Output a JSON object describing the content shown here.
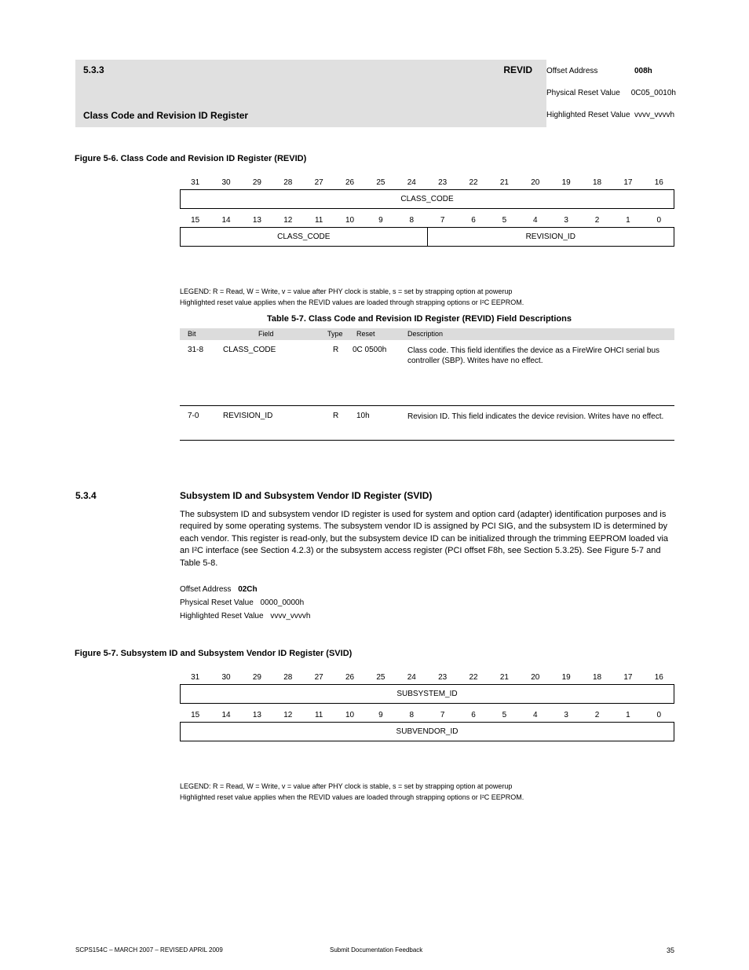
{
  "topband": {
    "label": "5.3.3",
    "abbr": "REVID",
    "sub": "Class Code and Revision ID Register"
  },
  "offbox": {
    "offset_k": "Offset Address",
    "offset_v": "008h",
    "reset_k": "Physical Reset Value",
    "reset_v": "0C05_0010h",
    "hi_k": "Highlighted Reset Value",
    "hi_v": "vvvv_vvvvh"
  },
  "sect_b": {
    "num": "5.3.4",
    "title": "Subsystem ID and Subsystem Vendor ID Register (SVID)"
  },
  "fig1": "Figure 5-6. Class Code and Revision ID Register (REVID)",
  "fig2": "Figure 5-7. Subsystem ID and Subsystem Vendor ID Register (SVID)",
  "bits_hi": [
    "31",
    "30",
    "29",
    "28",
    "27",
    "26",
    "25",
    "24",
    "23",
    "22",
    "21",
    "20",
    "19",
    "18",
    "17",
    "16"
  ],
  "bits_lo": [
    "15",
    "14",
    "13",
    "12",
    "11",
    "10",
    "9",
    "8",
    "7",
    "6",
    "5",
    "4",
    "3",
    "2",
    "1",
    "0"
  ],
  "reg1": {
    "a": "CLASS_CODE",
    "b": "CLASS_CODE",
    "c": "REVISION_ID"
  },
  "reg2": {
    "a": "SUBSYSTEM_ID",
    "b": "SUBVENDOR_ID"
  },
  "legend1a": "LEGEND: R = Read, W = Write, v = value after PHY clock is stable, s = set by strapping option at powerup",
  "legend1b": "Highlighted reset value applies when the REVID values are loaded through strapping options or I²C EEPROM.",
  "tbl1": {
    "title": "Table 5-7. Class Code and Revision ID Register (REVID) Field Descriptions",
    "h": {
      "bit": "Bit",
      "field": "Field",
      "type": "Type",
      "reset": "Reset",
      "desc": "Description"
    },
    "r1": {
      "bit": "31-8",
      "field": "CLASS_CODE",
      "type": "R",
      "reset": "0C 0500h",
      "desc": "Class code. This field identifies the device as a FireWire OHCI serial bus controller (SBP). Writes have no effect."
    },
    "r2": {
      "bit": "7-0",
      "field": "REVISION_ID",
      "type": "R",
      "reset": "10h",
      "desc": "Revision ID. This field indicates the device revision. Writes have no effect."
    }
  },
  "para1": "The subsystem ID and subsystem vendor ID register is used for system and option card (adapter) identification purposes and is required by some operating systems. The subsystem vendor ID is assigned by PCI SIG, and the subsystem ID is determined by each vendor. This register is read-only, but the subsystem device ID can be initialized through the trimming EEPROM loaded via an I²C interface (see Section 4.2.3) or the subsystem access register (PCI offset F8h, see Section 5.3.25). See Figure 5-7 and Table 5-8.",
  "off2": {
    "offset_v": "02Ch",
    "reset_v": "0000_0000h",
    "hi_v": "vvvv_vvvvh"
  },
  "foot": {
    "l": "SCPS154C – MARCH 2007 – REVISED APRIL 2009",
    "c": "Submit Documentation Feedback",
    "r": "35"
  }
}
